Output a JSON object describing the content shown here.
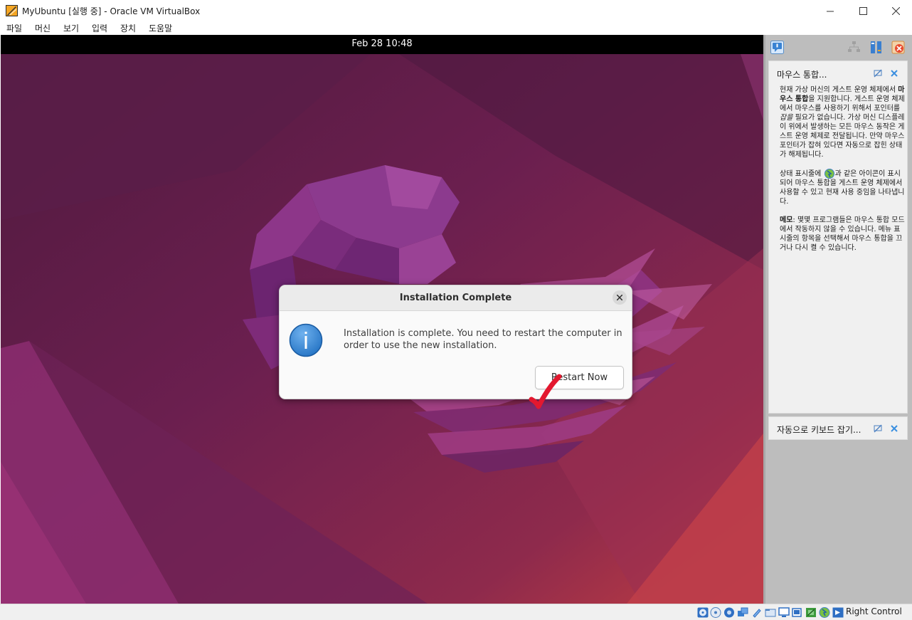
{
  "window": {
    "title": "MyUbuntu [실행 중] - Oracle VM VirtualBox",
    "app_icon": "virtualbox-vm-icon",
    "controls": [
      "minimize-icon",
      "maximize-icon",
      "close-icon"
    ]
  },
  "menu": {
    "items": [
      "파일",
      "머신",
      "보기",
      "입력",
      "장치",
      "도움말"
    ]
  },
  "guest": {
    "clock": "Feb 28  10:48",
    "wallpaper_colors": {
      "base": "#6b1f4f",
      "accent": "#a4327a",
      "warm": "#c8414a"
    },
    "dialog": {
      "title": "Installation Complete",
      "message": "Installation is complete. You need to restart the computer in order to use the new installation.",
      "button": "Restart Now",
      "icon": "info-icon",
      "annotation": "red-checkmark-icon"
    }
  },
  "side_panel": {
    "toolbar_icons": [
      "notification-icon",
      "network-icon",
      "storage-icon",
      "close-panel-icon"
    ],
    "cards": [
      {
        "title": "마우스 통합...",
        "paragraphs": [
          {
            "p1": "현재 가상 머신의 게스트 운영 체제에서 ",
            "bold": "마우스 통합",
            "p2": "을 지원합니다. 게스트 운영 체제에서 마우스를 사용하기 위해서 포인터를 ",
            "italic": "잡을",
            "p3": " 필요가 없습니다. 가상 머신 디스플레이 위에서 발생하는 모든 마우스 동작은 게스트 운영 체제로 전달됩니다. 만약 마우스 포인터가 잡혀 있다면 자동으로 잡힌 상태가 해제됩니다."
          },
          {
            "p1": "상태 표시줄에 ",
            "icon": "mouse-integration-icon",
            "p2": "과 같은 아이콘이 표시되어 마우스 통합을 게스트 운영 체제에서 사용할 수 있고 현재 사용 중임을 나타냅니다."
          },
          {
            "bold": "메모",
            "p2": ": 몇몇 프로그램들은 마우스 통합 모드에서 작동하지 않을 수 있습니다. 메뉴 표시줄의 항목을 선택해서 마우스 통합을 끄거나 다시 켤 수 있습니다."
          }
        ]
      },
      {
        "title": "자동으로 키보드 잡기..."
      }
    ]
  },
  "statusbar": {
    "icons": [
      "optical-disk-icon",
      "hard-disk-icon",
      "audio-icon",
      "network-adapter-icon",
      "usb-icon",
      "shared-folders-icon",
      "display-icon",
      "recording-icon",
      "cpu-icon",
      "mouse-integration-icon",
      "keyboard-capture-icon"
    ],
    "host_key": "Right Control"
  }
}
